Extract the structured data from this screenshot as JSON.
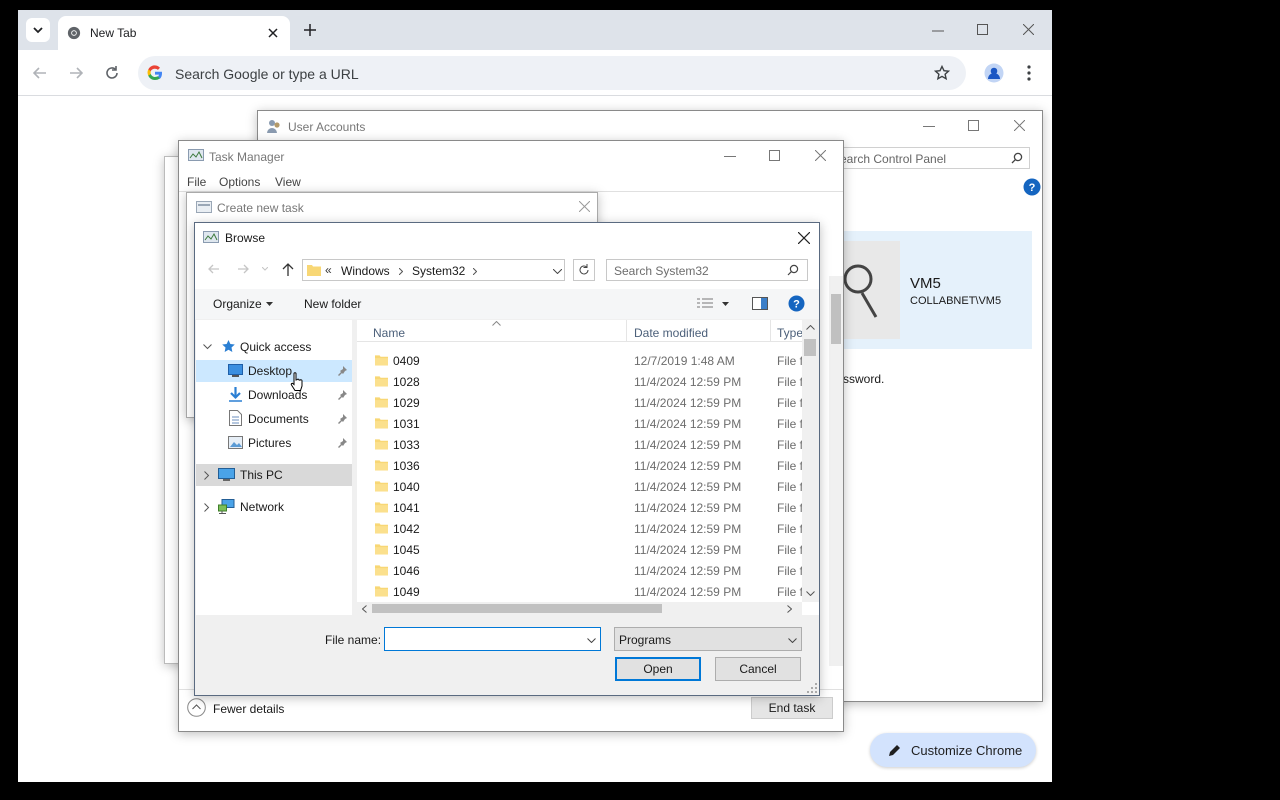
{
  "chrome": {
    "tab_title": "New Tab",
    "omnibox_placeholder": "Search Google or type a URL",
    "customize_label": "Customize Chrome"
  },
  "user_accounts": {
    "title": "User Accounts",
    "search_placeholder": "earch Control Panel",
    "user_name": "VM5",
    "user_domain": "COLLABNET\\VM5",
    "partial_text": "ssword."
  },
  "task_manager": {
    "title": "Task Manager",
    "menu": [
      "File",
      "Options",
      "View"
    ],
    "fewer_details": "Fewer details",
    "end_task": "End task"
  },
  "create_task": {
    "title": "Create new task"
  },
  "browse": {
    "title": "Browse",
    "breadcrumb": {
      "prefix": "«",
      "items": [
        "Windows",
        "System32"
      ]
    },
    "search_placeholder": "Search System32",
    "organize": "Organize",
    "new_folder": "New folder",
    "nav": {
      "quick_access": "Quick access",
      "items": [
        "Desktop",
        "Downloads",
        "Documents",
        "Pictures"
      ],
      "this_pc": "This PC",
      "network": "Network"
    },
    "columns": {
      "name": "Name",
      "date": "Date modified",
      "type": "Type"
    },
    "files": [
      {
        "name": "0409",
        "date": "12/7/2019 1:48 AM",
        "type": "File f"
      },
      {
        "name": "1028",
        "date": "11/4/2024 12:59 PM",
        "type": "File f"
      },
      {
        "name": "1029",
        "date": "11/4/2024 12:59 PM",
        "type": "File f"
      },
      {
        "name": "1031",
        "date": "11/4/2024 12:59 PM",
        "type": "File f"
      },
      {
        "name": "1033",
        "date": "11/4/2024 12:59 PM",
        "type": "File f"
      },
      {
        "name": "1036",
        "date": "11/4/2024 12:59 PM",
        "type": "File f"
      },
      {
        "name": "1040",
        "date": "11/4/2024 12:59 PM",
        "type": "File f"
      },
      {
        "name": "1041",
        "date": "11/4/2024 12:59 PM",
        "type": "File f"
      },
      {
        "name": "1042",
        "date": "11/4/2024 12:59 PM",
        "type": "File f"
      },
      {
        "name": "1045",
        "date": "11/4/2024 12:59 PM",
        "type": "File f"
      },
      {
        "name": "1046",
        "date": "11/4/2024 12:59 PM",
        "type": "File f"
      },
      {
        "name": "1049",
        "date": "11/4/2024 12:59 PM",
        "type": "File f"
      }
    ],
    "file_name_label": "File name:",
    "file_name_value": "",
    "file_type": "Programs",
    "open": "Open",
    "cancel": "Cancel"
  }
}
